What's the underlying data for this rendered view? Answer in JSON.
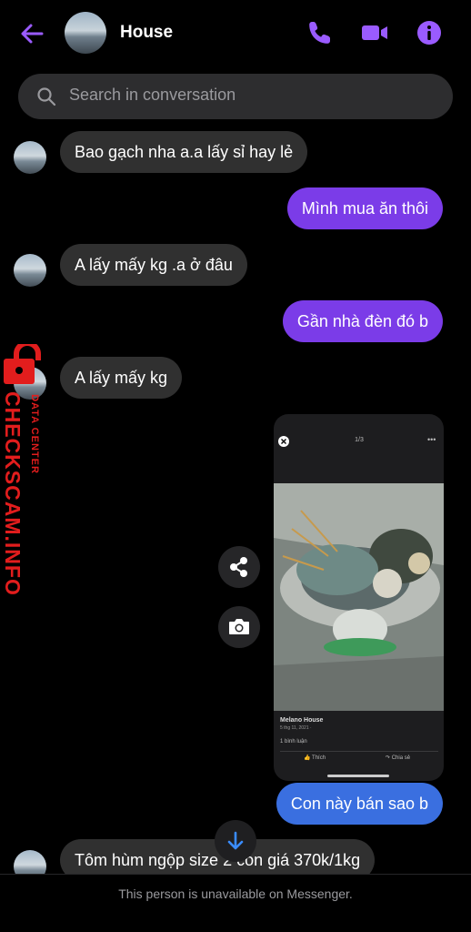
{
  "header": {
    "title": "House"
  },
  "search": {
    "placeholder": "Search in conversation"
  },
  "messages": [
    {
      "side": "in",
      "text": "Bao gạch nha a.a lấy sỉ hay lẻ"
    },
    {
      "side": "out",
      "text": "Mình mua ăn thôi"
    },
    {
      "side": "in",
      "text": "A lấy mấy kg .a ở đâu"
    },
    {
      "side": "out",
      "text": "Gần nhà đèn đó b"
    },
    {
      "side": "in",
      "text": "A lấy mấy kg"
    },
    {
      "side": "out",
      "text": "Con này bán sao b"
    },
    {
      "side": "in",
      "text": "Tôm hùm ngộp size 2 con giá 370k/1kg"
    }
  ],
  "image_card": {
    "counter": "1/3",
    "page_name": "Melano House",
    "post_date": "5 thg 11, 2021 · ",
    "comments": "1 bình luận",
    "like": "Thích",
    "share": "Chia sẻ"
  },
  "footer": {
    "text": "This person is unavailable on Messenger."
  },
  "watermark": {
    "text": "CHECKSCAM.INFO",
    "sub": "DATA CENTER"
  },
  "colors": {
    "accent": "#7b3ce8",
    "blue": "#3a6fe0",
    "bubble_in": "#303030"
  },
  "icons": [
    "back-arrow-icon",
    "phone-icon",
    "video-icon",
    "info-icon",
    "search-icon",
    "share-icon",
    "camera-icon",
    "arrow-down-icon",
    "lock-icon"
  ]
}
